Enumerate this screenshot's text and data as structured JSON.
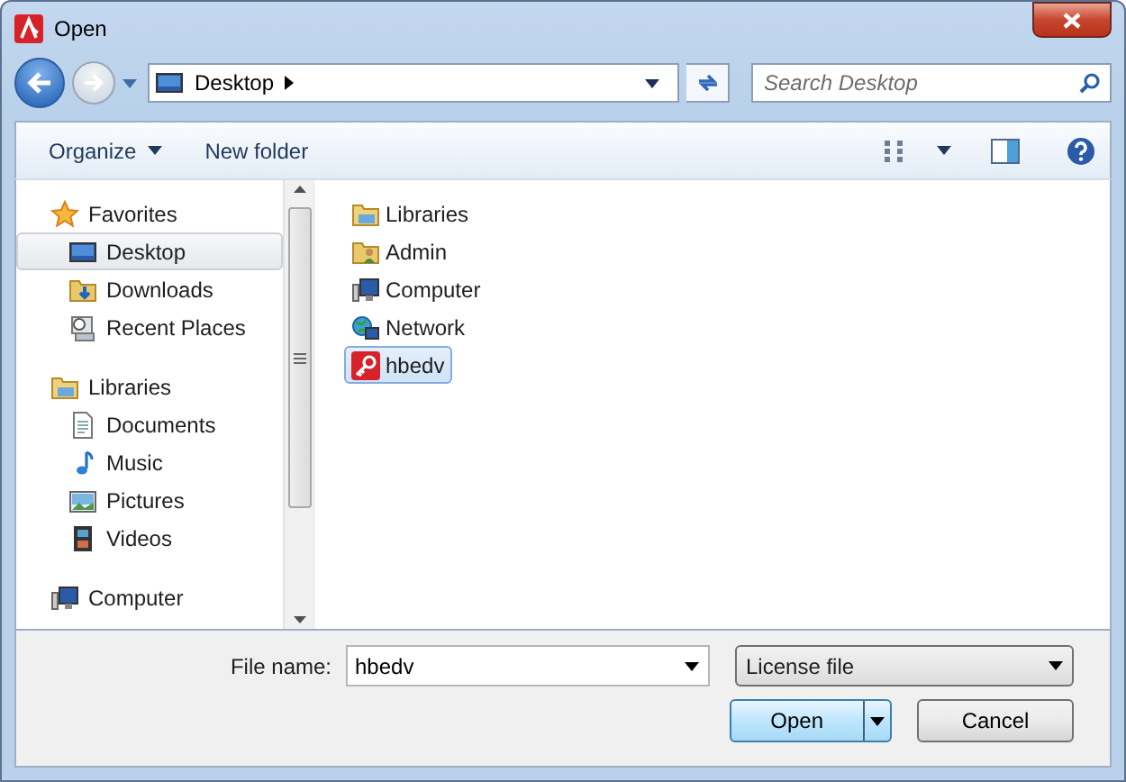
{
  "window": {
    "title": "Open"
  },
  "address": {
    "location": "Desktop",
    "search_placeholder": "Search Desktop"
  },
  "toolbar": [
    {
      "label": "Organize",
      "kind": "menu"
    },
    {
      "label": "New folder",
      "kind": "plain"
    }
  ],
  "sidebar": {
    "items": [
      {
        "label": "Favorites",
        "kind": "star",
        "selected": false,
        "children": [
          {
            "label": "Desktop",
            "kind": "desktop",
            "selected": true
          },
          {
            "label": "Downloads",
            "kind": "downloads",
            "selected": false
          },
          {
            "label": "Recent Places",
            "kind": "recent",
            "selected": false
          }
        ]
      },
      {
        "label": "Libraries",
        "kind": "library",
        "selected": false,
        "children": [
          {
            "label": "Documents",
            "kind": "document",
            "selected": false
          },
          {
            "label": "Music",
            "kind": "music",
            "selected": false
          },
          {
            "label": "Pictures",
            "kind": "picture",
            "selected": false
          },
          {
            "label": "Videos",
            "kind": "video",
            "selected": false
          }
        ]
      },
      {
        "label": "Computer",
        "kind": "computer",
        "selected": false
      }
    ]
  },
  "files": [
    {
      "label": "Libraries",
      "kind": "library",
      "selected": false
    },
    {
      "label": "Admin",
      "kind": "user-folder",
      "selected": false
    },
    {
      "label": "Computer",
      "kind": "computer",
      "selected": false
    },
    {
      "label": "Network",
      "kind": "network",
      "selected": false
    },
    {
      "label": "hbedv",
      "kind": "key",
      "selected": true
    }
  ],
  "file_name": {
    "label": "File name:",
    "value": "hbedv"
  },
  "file_type": {
    "value": "License file"
  },
  "buttons": [
    {
      "label": "Open",
      "kind": "split",
      "default": true
    },
    {
      "label": "Cancel",
      "kind": "plain",
      "default": false
    }
  ]
}
